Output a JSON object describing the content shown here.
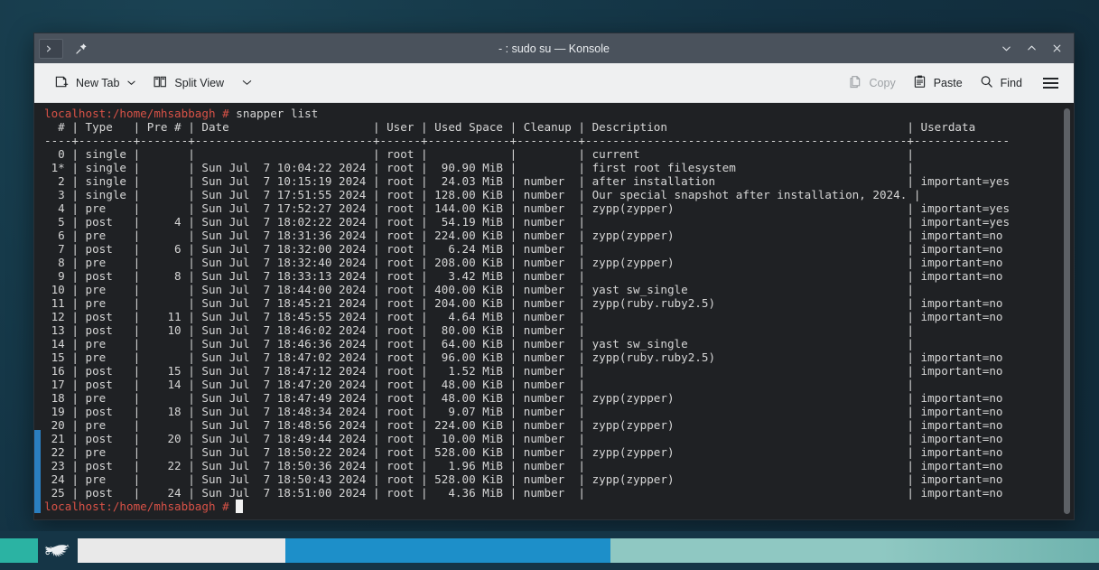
{
  "window": {
    "title": "- : sudo su — Konsole",
    "tab_icon": "terminal-icon",
    "pin_icon": "pin-icon",
    "controls": [
      {
        "name": "minimize",
        "glyph": "∨"
      },
      {
        "name": "maximize",
        "glyph": "∧"
      },
      {
        "name": "close",
        "glyph": "✕"
      }
    ]
  },
  "toolbar": {
    "new_tab_label": "New Tab",
    "split_view_label": "Split View",
    "copy_label": "Copy",
    "paste_label": "Paste",
    "find_label": "Find",
    "caret_glyph": "⌄",
    "menu_label": "hamburger-menu"
  },
  "terminal": {
    "prompt": "localhost:/home/mhsabbagh #",
    "command": "snapper list",
    "final_prompt": "localhost:/home/mhsabbagh #",
    "cursor": " ",
    "prompt_color": "#d85247",
    "text_color": "#d6d6d6",
    "background": "#1f2124",
    "header": "  # | Type   | Pre # | Date                     | User | Used Space | Cleanup | Description                                   | Userdata     ",
    "separator": "----+--------+-------+--------------------------+------+------------+---------+-----------------------------------------------+--------------",
    "columns": [
      "#",
      "Type",
      "Pre #",
      "Date",
      "User",
      "Used Space",
      "Cleanup",
      "Description",
      "Userdata"
    ],
    "rows": [
      {
        "num": "0",
        "type": "single",
        "pre": "",
        "date": "",
        "user": "root",
        "used": "",
        "cleanup": "",
        "description": "current",
        "userdata": ""
      },
      {
        "num": "1*",
        "type": "single",
        "pre": "",
        "date": "Sun Jul  7 10:04:22 2024",
        "user": "root",
        "used": " 90.90 MiB",
        "cleanup": "",
        "description": "first root filesystem",
        "userdata": ""
      },
      {
        "num": "2",
        "type": "single",
        "pre": "",
        "date": "Sun Jul  7 10:15:19 2024",
        "user": "root",
        "used": " 24.03 MiB",
        "cleanup": "number",
        "description": "after installation",
        "userdata": "important=yes"
      },
      {
        "num": "3",
        "type": "single",
        "pre": "",
        "date": "Sun Jul  7 17:51:55 2024",
        "user": "root",
        "used": "128.00 KiB",
        "cleanup": "number",
        "description": "Our special snapshot after installation, 2024.",
        "userdata": ""
      },
      {
        "num": "4",
        "type": "pre",
        "pre": "",
        "date": "Sun Jul  7 17:52:27 2024",
        "user": "root",
        "used": "144.00 KiB",
        "cleanup": "number",
        "description": "zypp(zypper)",
        "userdata": "important=yes"
      },
      {
        "num": "5",
        "type": "post",
        "pre": "4",
        "date": "Sun Jul  7 18:02:22 2024",
        "user": "root",
        "used": " 54.19 MiB",
        "cleanup": "number",
        "description": "",
        "userdata": "important=yes"
      },
      {
        "num": "6",
        "type": "pre",
        "pre": "",
        "date": "Sun Jul  7 18:31:36 2024",
        "user": "root",
        "used": "224.00 KiB",
        "cleanup": "number",
        "description": "zypp(zypper)",
        "userdata": "important=no"
      },
      {
        "num": "7",
        "type": "post",
        "pre": "6",
        "date": "Sun Jul  7 18:32:00 2024",
        "user": "root",
        "used": "  6.24 MiB",
        "cleanup": "number",
        "description": "",
        "userdata": "important=no"
      },
      {
        "num": "8",
        "type": "pre",
        "pre": "",
        "date": "Sun Jul  7 18:32:40 2024",
        "user": "root",
        "used": "208.00 KiB",
        "cleanup": "number",
        "description": "zypp(zypper)",
        "userdata": "important=no"
      },
      {
        "num": "9",
        "type": "post",
        "pre": "8",
        "date": "Sun Jul  7 18:33:13 2024",
        "user": "root",
        "used": "  3.42 MiB",
        "cleanup": "number",
        "description": "",
        "userdata": "important=no"
      },
      {
        "num": "10",
        "type": "pre",
        "pre": "",
        "date": "Sun Jul  7 18:44:00 2024",
        "user": "root",
        "used": "400.00 KiB",
        "cleanup": "number",
        "description": "yast sw_single",
        "userdata": ""
      },
      {
        "num": "11",
        "type": "pre",
        "pre": "",
        "date": "Sun Jul  7 18:45:21 2024",
        "user": "root",
        "used": "204.00 KiB",
        "cleanup": "number",
        "description": "zypp(ruby.ruby2.5)",
        "userdata": "important=no"
      },
      {
        "num": "12",
        "type": "post",
        "pre": "11",
        "date": "Sun Jul  7 18:45:55 2024",
        "user": "root",
        "used": "  4.64 MiB",
        "cleanup": "number",
        "description": "",
        "userdata": "important=no"
      },
      {
        "num": "13",
        "type": "post",
        "pre": "10",
        "date": "Sun Jul  7 18:46:02 2024",
        "user": "root",
        "used": " 80.00 KiB",
        "cleanup": "number",
        "description": "",
        "userdata": ""
      },
      {
        "num": "14",
        "type": "pre",
        "pre": "",
        "date": "Sun Jul  7 18:46:36 2024",
        "user": "root",
        "used": " 64.00 KiB",
        "cleanup": "number",
        "description": "yast sw_single",
        "userdata": ""
      },
      {
        "num": "15",
        "type": "pre",
        "pre": "",
        "date": "Sun Jul  7 18:47:02 2024",
        "user": "root",
        "used": " 96.00 KiB",
        "cleanup": "number",
        "description": "zypp(ruby.ruby2.5)",
        "userdata": "important=no"
      },
      {
        "num": "16",
        "type": "post",
        "pre": "15",
        "date": "Sun Jul  7 18:47:12 2024",
        "user": "root",
        "used": "  1.52 MiB",
        "cleanup": "number",
        "description": "",
        "userdata": "important=no"
      },
      {
        "num": "17",
        "type": "post",
        "pre": "14",
        "date": "Sun Jul  7 18:47:20 2024",
        "user": "root",
        "used": " 48.00 KiB",
        "cleanup": "number",
        "description": "",
        "userdata": ""
      },
      {
        "num": "18",
        "type": "pre",
        "pre": "",
        "date": "Sun Jul  7 18:47:49 2024",
        "user": "root",
        "used": " 48.00 KiB",
        "cleanup": "number",
        "description": "zypp(zypper)",
        "userdata": "important=no"
      },
      {
        "num": "19",
        "type": "post",
        "pre": "18",
        "date": "Sun Jul  7 18:48:34 2024",
        "user": "root",
        "used": "  9.07 MiB",
        "cleanup": "number",
        "description": "",
        "userdata": "important=no"
      },
      {
        "num": "20",
        "type": "pre",
        "pre": "",
        "date": "Sun Jul  7 18:48:56 2024",
        "user": "root",
        "used": "224.00 KiB",
        "cleanup": "number",
        "description": "zypp(zypper)",
        "userdata": "important=no"
      },
      {
        "num": "21",
        "type": "post",
        "pre": "20",
        "date": "Sun Jul  7 18:49:44 2024",
        "user": "root",
        "used": " 10.00 MiB",
        "cleanup": "number",
        "description": "",
        "userdata": "important=no"
      },
      {
        "num": "22",
        "type": "pre",
        "pre": "",
        "date": "Sun Jul  7 18:50:22 2024",
        "user": "root",
        "used": "528.00 KiB",
        "cleanup": "number",
        "description": "zypp(zypper)",
        "userdata": "important=no"
      },
      {
        "num": "23",
        "type": "post",
        "pre": "22",
        "date": "Sun Jul  7 18:50:36 2024",
        "user": "root",
        "used": "  1.96 MiB",
        "cleanup": "number",
        "description": "",
        "userdata": "important=no"
      },
      {
        "num": "24",
        "type": "pre",
        "pre": "",
        "date": "Sun Jul  7 18:50:43 2024",
        "user": "root",
        "used": "528.00 KiB",
        "cleanup": "number",
        "description": "zypp(zypper)",
        "userdata": "important=no"
      },
      {
        "num": "25",
        "type": "post",
        "pre": "24",
        "date": "Sun Jul  7 18:51:00 2024",
        "user": "root",
        "used": "  4.36 MiB",
        "cleanup": "number",
        "description": "",
        "userdata": "important=no"
      }
    ]
  },
  "taskbar": {
    "logo": "opensuse-chameleon-icon",
    "accent_teal": "#2bb3a3",
    "accent_blue": "#1d8fc9",
    "accent_mint": "#8fc8c2"
  }
}
